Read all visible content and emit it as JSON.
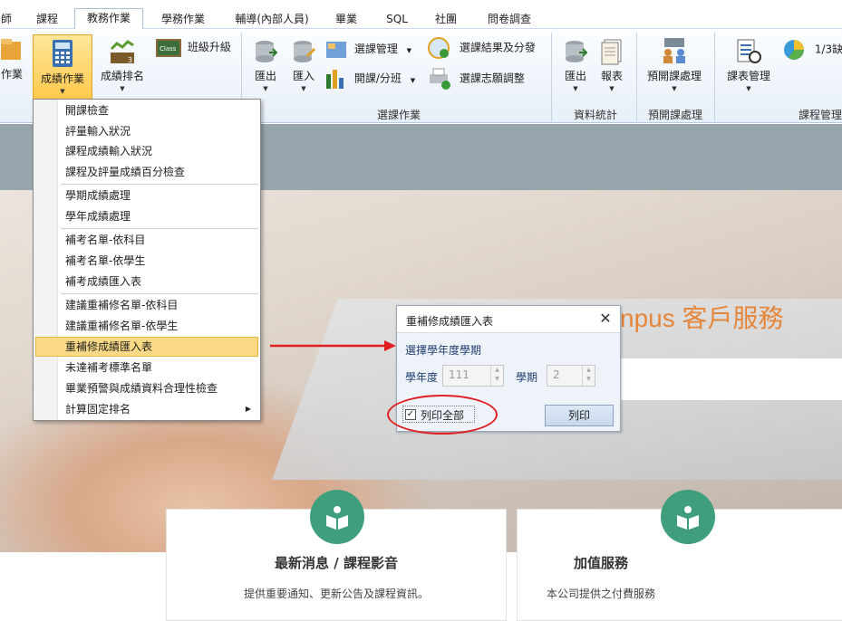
{
  "tabs": [
    "師",
    "課程",
    "教務作業",
    "學務作業",
    "輔導(內部人員)",
    "畢業",
    "SQL",
    "社團",
    "問卷調查"
  ],
  "ribbon": {
    "buttons": {
      "left_cut": "作業",
      "grades": "成績作業",
      "ranking": "成績排名",
      "class_upgrade": "班級升級",
      "export1": "匯出",
      "import1": "匯入",
      "course_mgmt": "選課管理",
      "open_class": "開課/分班",
      "result_split": "選課結果及分發",
      "wish_adjust": "選課志願調整",
      "export2": "匯出",
      "report": "報表",
      "pre_open": "預開課處理",
      "schedule": "課表管理",
      "one_third": "1/3缺"
    },
    "groups": {
      "course_ops": "選課作業",
      "stats": "資料統計",
      "pre_open": "預開課處理",
      "course_mgmt": "課程管理"
    }
  },
  "menu": {
    "items": [
      "開課檢查",
      "評量輸入狀況",
      "課程成績輸入狀況",
      "課程及評量成績百分檢查",
      "學期成績處理",
      "學年成績處理",
      "補考名單-依科目",
      "補考名單-依學生",
      "補考成績匯入表",
      "建議重補修名單-依科目",
      "建議重補修名單-依學生",
      "重補修成績匯入表",
      "未達補考標準名單",
      "畢業預警與成績資料合理性檢查",
      "計算固定排名"
    ]
  },
  "hero": {
    "text": "npus 客戶服務"
  },
  "cards": [
    {
      "title": "最新消息 / 課程影音",
      "desc": "提供重要通知、更新公告及課程資訊。"
    },
    {
      "title": "加值服務",
      "desc": "本公司提供之付費服務"
    }
  ],
  "dialog": {
    "title": "重補修成績匯入表",
    "section": "選擇學年度學期",
    "year_label": "學年度",
    "year_value": "111",
    "term_label": "學期",
    "term_value": "2",
    "print_all_label": "列印全部",
    "print_all_checked": true,
    "print_button": "列印"
  },
  "colors": {
    "accent": "#f9d985",
    "annotation": "#e02020",
    "card_icon": "#3f9f7c",
    "hero_text": "#e6863a"
  }
}
